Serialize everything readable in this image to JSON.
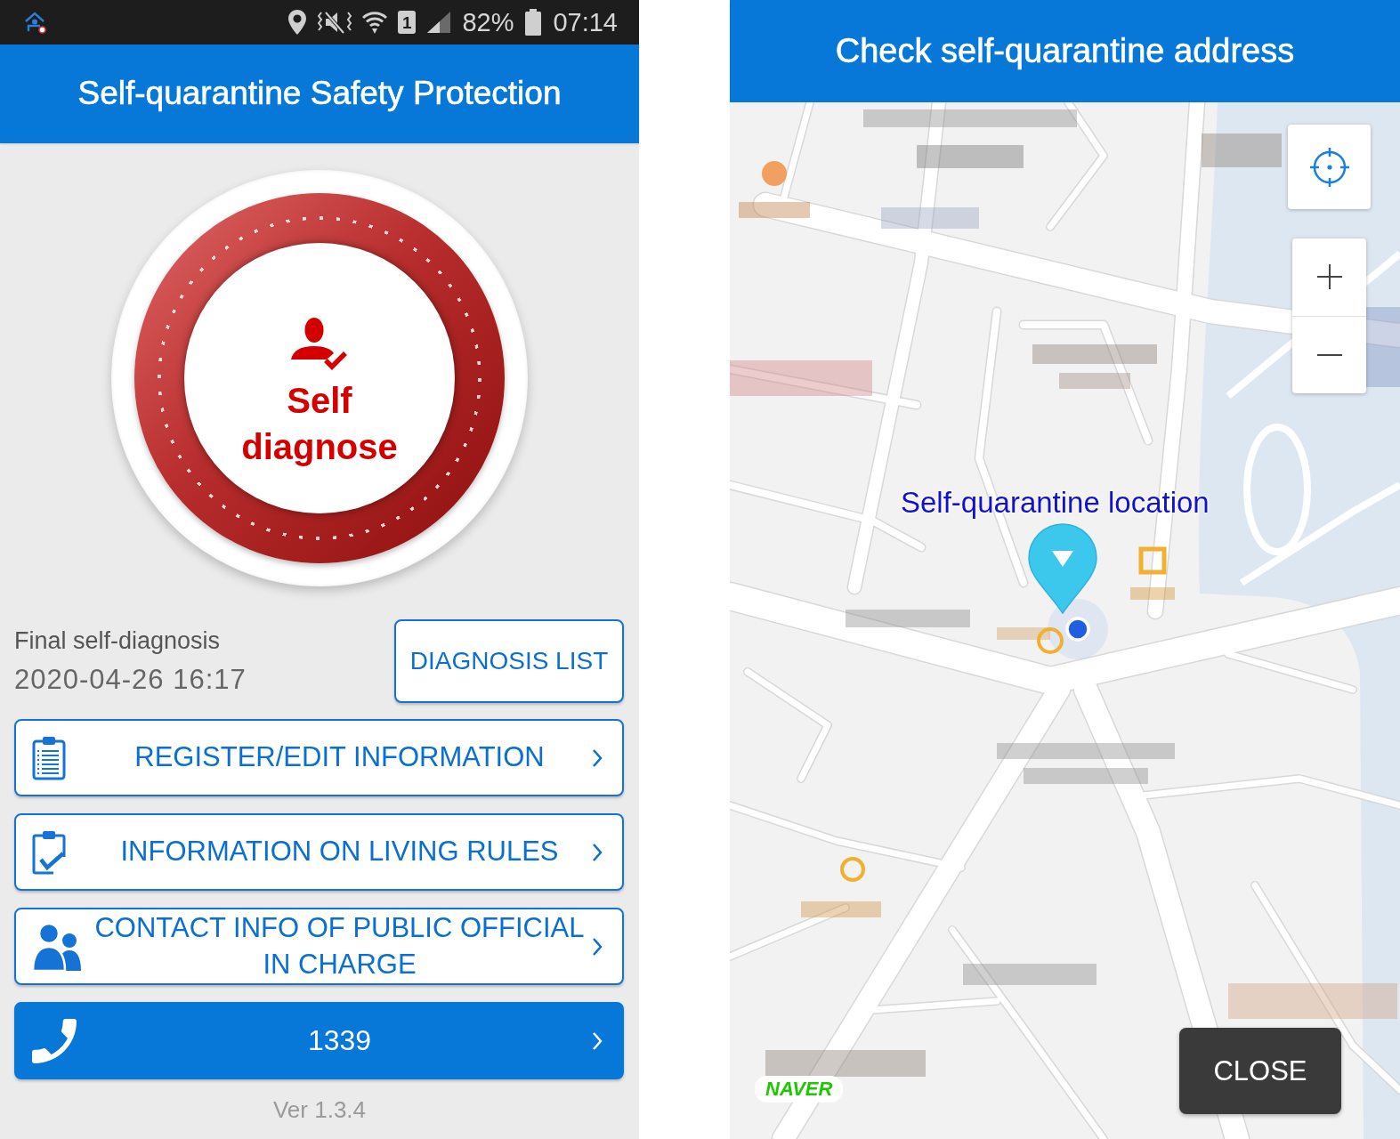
{
  "home_screen": {
    "status_bar": {
      "sim_slot": "1",
      "battery": "82%",
      "time": "07:14"
    },
    "title": "Self-quarantine Safety Protection",
    "diagnose_button": {
      "label": "Self diagnose"
    },
    "last_diagnosis": {
      "label": "Final self-diagnosis",
      "timestamp": "2020-04-26 16:17"
    },
    "diagnosis_list_button": {
      "label": "DIAGNOSIS LIST"
    },
    "menu": [
      {
        "kind": "register",
        "label": "REGISTER/EDIT INFORMATION"
      },
      {
        "kind": "rules",
        "label": "INFORMATION ON LIVING RULES"
      },
      {
        "kind": "contact",
        "label": "CONTACT INFO OF PUBLIC OFFICIAL IN CHARGE"
      },
      {
        "kind": "call",
        "label": "1339"
      }
    ],
    "version": "Ver 1.3.4"
  },
  "address_screen": {
    "title": "Check self-quarantine address",
    "map": {
      "location_label": "Self-quarantine location",
      "provider_logo": "NAVER"
    },
    "close_button": {
      "label": "CLOSE"
    }
  }
}
